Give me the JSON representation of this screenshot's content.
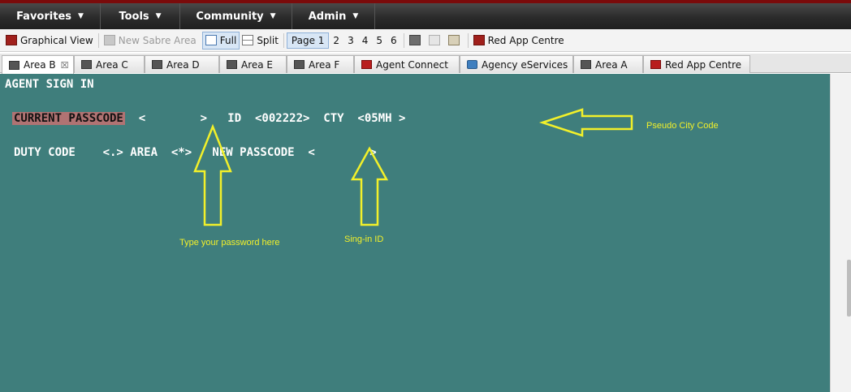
{
  "menubar": {
    "items": [
      {
        "label": "Favorites",
        "arrow": "▼"
      },
      {
        "label": "Tools",
        "arrow": "▼"
      },
      {
        "label": "Community",
        "arrow": "▼"
      },
      {
        "label": "Admin",
        "arrow": "▼"
      }
    ]
  },
  "toolbar": {
    "graphical_view": "Graphical View",
    "new_sabre_area": "New Sabre Area",
    "full": "Full",
    "split": "Split",
    "pages": [
      "Page 1",
      "2",
      "3",
      "4",
      "5",
      "6"
    ],
    "active_page": "Page 1",
    "red_app_centre": "Red App Centre"
  },
  "tabs": [
    {
      "label": "Area B",
      "icon": "terminal-icon",
      "selected": true,
      "closable": true
    },
    {
      "label": "Area C",
      "icon": "terminal-icon"
    },
    {
      "label": "Area D",
      "icon": "terminal-icon"
    },
    {
      "label": "Area E",
      "icon": "terminal-icon"
    },
    {
      "label": "Area F",
      "icon": "terminal-icon"
    },
    {
      "label": "Agent Connect",
      "icon": "ac-icon"
    },
    {
      "label": "Agency eServices",
      "icon": "eservices-icon"
    },
    {
      "label": "Area A",
      "icon": "terminal-icon"
    },
    {
      "label": "Red App Centre",
      "icon": "red-app-icon"
    }
  ],
  "terminal": {
    "line1": "AGENT SIGN IN",
    "current_passcode": "CURRENT PASSCODE",
    "line2_rest": "  <        >   ID  <002222>  CTY  <05MH >",
    "line3": "DUTY CODE    <.> AREA  <*>   NEW PASSCODE  <        >",
    "background": "#3f7e7c"
  },
  "annotations": {
    "pseudo_city": "Pseudo City Code",
    "password": "Type your password here",
    "signin": "Sing-in ID",
    "color": "#f2f02a"
  }
}
